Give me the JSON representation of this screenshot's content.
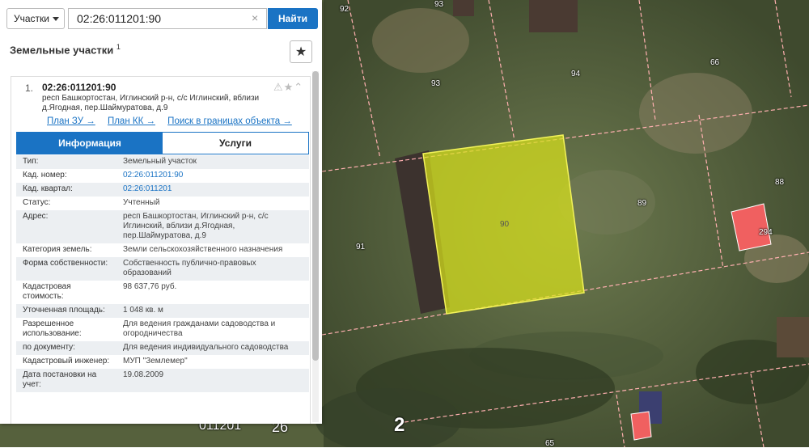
{
  "search": {
    "type_label": "Участки",
    "query": "02:26:011201:90",
    "find_label": "Найти",
    "clear_glyph": "×"
  },
  "panel": {
    "title": "Земельные участки",
    "count": "1",
    "star_glyph": "★"
  },
  "result": {
    "index": "1.",
    "cad_number": "02:26:011201:90",
    "address": "респ Башкортостан, Иглинский р-н, с/с Иглинский, вблизи д.Ягодная, пер.Шаймуратова, д.9",
    "icons": "⚠★⌃",
    "links": [
      "План ЗУ →",
      "План КК →",
      "Поиск в границах объекта →"
    ],
    "tabs": [
      "Информация",
      "Услуги"
    ],
    "rows": [
      {
        "k": "Тип:",
        "v": "Земельный участок"
      },
      {
        "k": "Кад. номер:",
        "v": "02:26:011201:90"
      },
      {
        "k": "Кад. квартал:",
        "v": "02:26:011201"
      },
      {
        "k": "Статус:",
        "v": "Учтенный"
      },
      {
        "k": "Адрес:",
        "v": "респ Башкортостан, Иглинский р-н, с/с Иглинский, вблизи д.Ягодная, пер.Шаймуратова, д.9"
      },
      {
        "k": "Категория земель:",
        "v": "Земли сельскохозяйственного назначения"
      },
      {
        "k": "Форма собственности:",
        "v": "Собственность публично-правовых образований"
      },
      {
        "k": "Кадастровая стоимость:",
        "v": "98 637,76 руб."
      },
      {
        "k": "Уточненная площадь:",
        "v": "1 048 кв. м"
      },
      {
        "k": "Разрешенное использование:",
        "v": "Для ведения гражданами садоводства и огородничества"
      },
      {
        "k": "по документу:",
        "v": "Для ведения индивидуального садоводства"
      },
      {
        "k": "Кадастровый инженер:",
        "v": "МУП \"Землемер\""
      },
      {
        "k": "Дата постановки на учет:",
        "v": "19.08.2009"
      }
    ]
  },
  "map": {
    "labels": [
      "92",
      "93",
      "93",
      "94",
      "66",
      "90",
      "89",
      "88",
      "294",
      "91",
      "2",
      "26",
      "011201",
      "65"
    ],
    "colors": {
      "selected": "#d8e21c",
      "building": "#f06060",
      "boundary": "#ffb0b0",
      "accent": "#1a73c4"
    }
  }
}
